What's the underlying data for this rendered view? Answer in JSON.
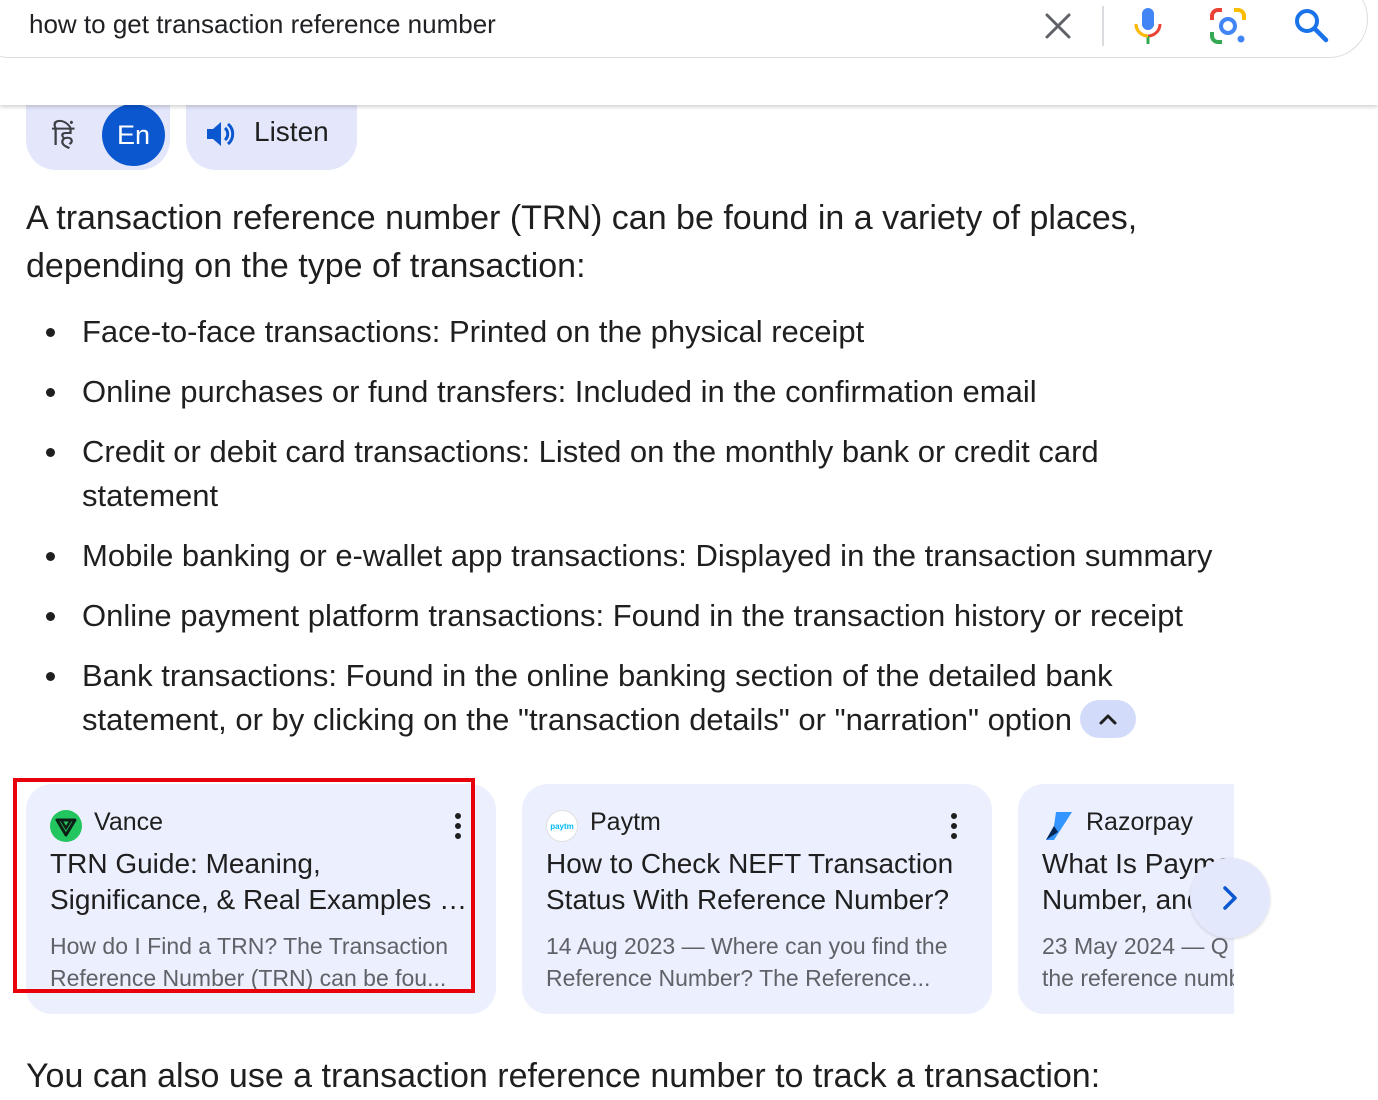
{
  "search": {
    "query": "how to get transaction reference number"
  },
  "language": {
    "hindi_label": "हिं",
    "english_label": "En",
    "active": "En"
  },
  "listen": {
    "label": "Listen"
  },
  "answer": {
    "intro": "A transaction reference number (TRN) can be found in a variety of places, depending on the type of transaction:",
    "bullets": [
      "Face-to-face transactions: Printed on the physical receipt",
      "Online purchases or fund transfers: Included in the confirmation email",
      "Credit or debit card transactions: Listed on the monthly bank or credit card statement",
      "Mobile banking or e-wallet app transactions: Displayed in the transaction summary",
      "Online payment platform transactions: Found in the transaction history or receipt",
      "Bank transactions: Found in the online banking section of the detailed bank statement, or by clicking on the \"transaction details\" or \"narration\" option"
    ],
    "outro": "You can also use a transaction reference number to track a transaction:"
  },
  "cards": [
    {
      "source": "Vance",
      "title_line1": "TRN Guide: Meaning,",
      "title_line2": "Significance, & Real Examples -...",
      "snippet_line1": "How do I Find a TRN? The Transaction",
      "snippet_line2": "Reference Number (TRN) can be fou...",
      "icon": "vance-logo",
      "highlighted": true
    },
    {
      "source": "Paytm",
      "title_line1": "How to Check NEFT Transaction",
      "title_line2": "Status With Reference Number?",
      "snippet_line1": "14 Aug 2023 — Where can you find the",
      "snippet_line2": "Reference Number? The Reference...",
      "icon": "paytm-logo",
      "icon_text": "paytm"
    },
    {
      "source": "Razorpay",
      "title_line1": "What Is Payment Reference",
      "title_line2": "Number, and How to Find It?",
      "snippet_line1": "23 May 2024 — Q",
      "snippet_line2": "the reference number",
      "icon": "razorpay-logo"
    }
  ],
  "colors": {
    "accent": "#0b57d0",
    "chip_bg": "#e4e7fb",
    "card_bg": "#eceffd",
    "highlight": "#e8000b"
  }
}
